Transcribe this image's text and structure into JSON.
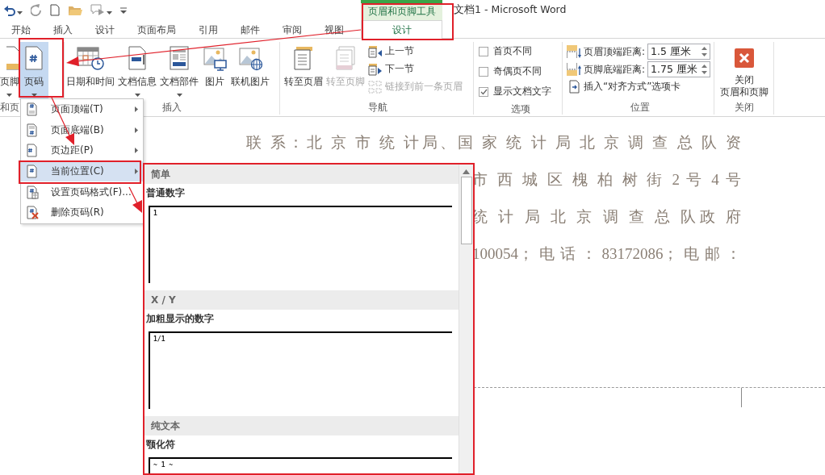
{
  "window": {
    "context_tool": "页眉和页脚工具",
    "title": "文档1 - Microsoft Word"
  },
  "tabs": [
    {
      "label": "开始",
      "selected": false,
      "kind": "normal"
    },
    {
      "label": "插入",
      "selected": false,
      "kind": "normal"
    },
    {
      "label": "设计",
      "selected": false,
      "kind": "normal"
    },
    {
      "label": "页面布局",
      "selected": false,
      "kind": "normal"
    },
    {
      "label": "引用",
      "selected": false,
      "kind": "normal"
    },
    {
      "label": "邮件",
      "selected": false,
      "kind": "normal"
    },
    {
      "label": "审阅",
      "selected": false,
      "kind": "normal"
    },
    {
      "label": "视图",
      "selected": false,
      "kind": "normal"
    },
    {
      "label": "设计",
      "selected": true,
      "kind": "context"
    }
  ],
  "ribbon": {
    "header_footer_group": {
      "label": "和页",
      "buttons": [
        {
          "label": "页脚",
          "dropdown": true,
          "selected": false
        },
        {
          "label": "页码",
          "dropdown": true,
          "selected": true
        }
      ]
    },
    "insert_group": {
      "label": "插入",
      "buttons": [
        {
          "label": "日期和时间",
          "dropdown": false
        },
        {
          "label": "文档信息",
          "dropdown": true
        },
        {
          "label": "文档部件",
          "dropdown": true
        },
        {
          "label": "图片",
          "dropdown": false
        },
        {
          "label": "联机图片",
          "dropdown": false
        }
      ]
    },
    "navigation_group": {
      "label": "导航",
      "large_buttons": [
        {
          "label": "转至页眉",
          "disabled": false
        },
        {
          "label": "转至页脚",
          "disabled": true
        }
      ],
      "small_buttons": [
        {
          "label": "上一节",
          "disabled": false
        },
        {
          "label": "下一节",
          "disabled": false
        },
        {
          "label": "链接到前一条页眉",
          "disabled": true
        }
      ]
    },
    "options_group": {
      "label": "选项",
      "checkboxes": [
        {
          "label": "首页不同",
          "checked": false
        },
        {
          "label": "奇偶页不同",
          "checked": false
        },
        {
          "label": "显示文档文字",
          "checked": true
        }
      ]
    },
    "position_group": {
      "label": "位置",
      "spinners": [
        {
          "label": "页眉顶端距离:",
          "value": "1.5 厘米"
        },
        {
          "label": "页脚底端距离:",
          "value": "1.75 厘米"
        }
      ],
      "insert_tab_button": "插入“对齐方式”选项卡"
    },
    "close_group": {
      "label": "关闭",
      "button_lines": [
        "关闭",
        "页眉和页脚"
      ]
    }
  },
  "page_number_menu": {
    "items": [
      {
        "label": "页面顶端(T)",
        "submenu": true,
        "selected": false
      },
      {
        "label": "页面底端(B)",
        "submenu": true,
        "selected": false
      },
      {
        "label": "页边距(P)",
        "submenu": true,
        "selected": false
      },
      {
        "label": "当前位置(C)",
        "submenu": true,
        "selected": true
      },
      {
        "label": "设置页码格式(F)...",
        "submenu": false,
        "selected": false
      },
      {
        "label": "删除页码(R)",
        "submenu": false,
        "selected": false
      }
    ]
  },
  "gallery": {
    "sections": [
      {
        "header": "简单",
        "items": [
          {
            "name": "普通数字",
            "preview": "1"
          }
        ]
      },
      {
        "header": "X / Y",
        "items": [
          {
            "name": "加粗显示的数字",
            "preview": "1/1"
          }
        ]
      },
      {
        "header": "纯文本",
        "items": [
          {
            "name": "颚化符",
            "preview": "~ 1 ~"
          }
        ]
      }
    ]
  },
  "document": {
    "lines": [
      "联 系：北 京 市 统 计局、国 家 统 计 局 北 京 调 查 总 队 资",
      "市 西 城 区 槐 柏 树 街 2 号 4 号",
      "统 计 局 北 京 调 查 总 队政 府",
      "100054；电话：83172086；电邮："
    ]
  }
}
